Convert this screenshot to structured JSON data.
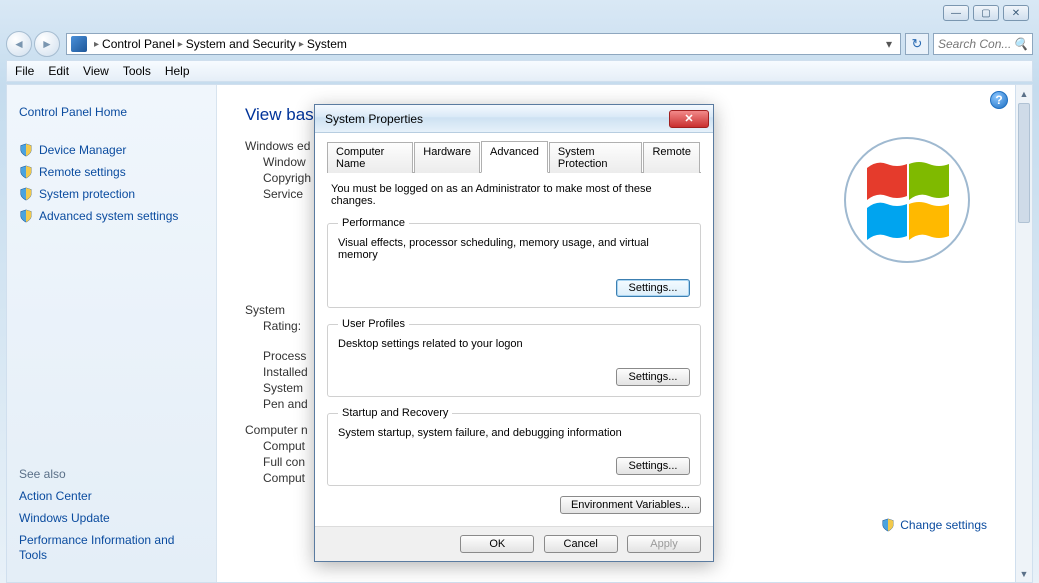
{
  "window_controls": {
    "min": "—",
    "max": "▢",
    "close": "✕"
  },
  "breadcrumb": {
    "items": [
      "Control Panel",
      "System and Security",
      "System"
    ]
  },
  "search": {
    "placeholder": "Search Con..."
  },
  "menubar": {
    "items": [
      "File",
      "Edit",
      "View",
      "Tools",
      "Help"
    ]
  },
  "sidebar": {
    "home": "Control Panel Home",
    "links": [
      "Device Manager",
      "Remote settings",
      "System protection",
      "Advanced system settings"
    ],
    "see_also_header": "See also",
    "see_also": [
      "Action Center",
      "Windows Update",
      "Performance Information and Tools"
    ]
  },
  "content": {
    "heading": "View bas",
    "we_header": "Windows ed",
    "we_lines": [
      "Window",
      "Copyrigh",
      "Service "
    ],
    "sys_header": "System",
    "sys_lines": [
      "Rating:",
      "Process",
      "Installed",
      "System ",
      "Pen and"
    ],
    "comp_header": "Computer n",
    "comp_lines": [
      "Comput",
      "Full con",
      "Comput"
    ],
    "change_link": "Change settings"
  },
  "dialog": {
    "title": "System Properties",
    "tabs": [
      "Computer Name",
      "Hardware",
      "Advanced",
      "System Protection",
      "Remote"
    ],
    "active_tab": 2,
    "note": "You must be logged on as an Administrator to make most of these changes.",
    "groups": [
      {
        "legend": "Performance",
        "text": "Visual effects, processor scheduling, memory usage, and virtual memory",
        "button": "Settings...",
        "focus": true
      },
      {
        "legend": "User Profiles",
        "text": "Desktop settings related to your logon",
        "button": "Settings...",
        "focus": false
      },
      {
        "legend": "Startup and Recovery",
        "text": "System startup, system failure, and debugging information",
        "button": "Settings...",
        "focus": false
      }
    ],
    "envvars": "Environment Variables...",
    "ok": "OK",
    "cancel": "Cancel",
    "apply": "Apply"
  }
}
